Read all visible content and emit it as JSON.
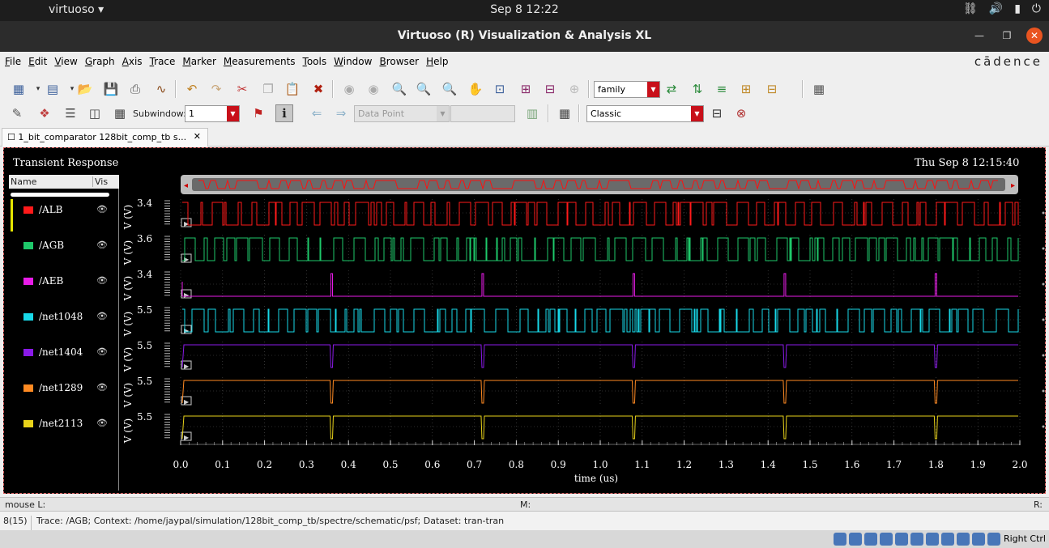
{
  "system": {
    "app_menu": "virtuoso ▾",
    "clock": "Sep 8  12:22"
  },
  "window": {
    "title": "Virtuoso (R) Visualization & Analysis XL"
  },
  "menubar": {
    "items": [
      "File",
      "Edit",
      "View",
      "Graph",
      "Axis",
      "Trace",
      "Marker",
      "Measurements",
      "Tools",
      "Window",
      "Browser",
      "Help"
    ],
    "brand": "cādence"
  },
  "toolbar1": {
    "family_combo": "family"
  },
  "toolbar2": {
    "subwindow_label": "Subwindow:",
    "subwindow_value": "1",
    "data_point_combo": "Data Point",
    "style_combo": "Classic"
  },
  "tab": {
    "label": "1_bit_comparator 128bit_comp_tb s..."
  },
  "plot": {
    "title": "Transient Response",
    "date": "Thu Sep 8 12:15:40",
    "legend_header_name": "Name",
    "legend_header_vis": "Vis",
    "traces": [
      {
        "name": "/ALB",
        "color": "#ff1a1a",
        "ymax": "3.4",
        "ylabel": "V (V)",
        "type": "busy"
      },
      {
        "name": "/AGB",
        "color": "#1ec86a",
        "ymax": "3.6",
        "ylabel": "V (V)",
        "type": "busy"
      },
      {
        "name": "/AEB",
        "color": "#e81ce8",
        "ymax": "3.4",
        "ylabel": "V (V)",
        "type": "pulse-up"
      },
      {
        "name": "/net1048",
        "color": "#18d8e8",
        "ymax": "5.5",
        "ylabel": "V (V)",
        "type": "busy"
      },
      {
        "name": "/net1404",
        "color": "#8a1ae8",
        "ymax": "5.5",
        "ylabel": "V (V)",
        "type": "pulse-down"
      },
      {
        "name": "/net1289",
        "color": "#ff8a22",
        "ymax": "5.5",
        "ylabel": "V (V)",
        "type": "pulse-down"
      },
      {
        "name": "/net2113",
        "color": "#e8d21a",
        "ymax": "5.5",
        "ylabel": "V (V)",
        "type": "pulse-down"
      }
    ],
    "x_ticks": [
      "0.0",
      "0.1",
      "0.2",
      "0.3",
      "0.4",
      "0.5",
      "0.6",
      "0.7",
      "0.8",
      "0.9",
      "1.0",
      "1.1",
      "1.2",
      "1.3",
      "1.4",
      "1.5",
      "1.6",
      "1.7",
      "1.8",
      "1.9",
      "2.0"
    ],
    "x_label": "time (us)",
    "pulse_times_us": [
      0.36,
      0.72,
      1.08,
      1.44,
      1.8
    ]
  },
  "status": {
    "mouse_l": "mouse L:",
    "mouse_m": "M:",
    "mouse_r": "R:",
    "count": "8(15)",
    "message": "Trace: /AGB; Context: /home/jaypal/simulation/128bit_comp_tb/spectre/schematic/psf; Dataset: tran-tran"
  },
  "host": {
    "right_ctrl": "Right Ctrl"
  }
}
